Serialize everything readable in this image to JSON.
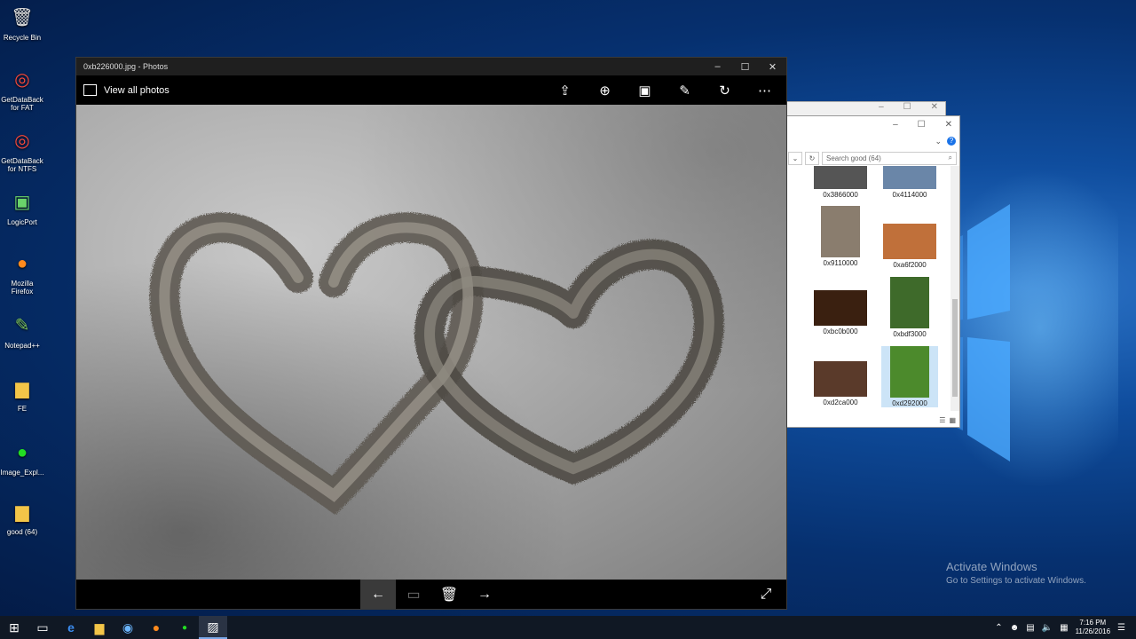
{
  "desktop": {
    "icons": [
      {
        "label": "Recycle Bin",
        "icon": "recycle-bin-icon"
      },
      {
        "label": "GetDataBack for FAT",
        "icon": "lifebuoy-icon"
      },
      {
        "label": "GetDataBack for NTFS",
        "icon": "lifebuoy-icon"
      },
      {
        "label": "LogicPort",
        "icon": "analyzer-icon"
      },
      {
        "label": "Mozilla Firefox",
        "icon": "firefox-icon"
      },
      {
        "label": "Notepad++",
        "icon": "notepad-icon"
      },
      {
        "label": "FE",
        "icon": "folder-icon"
      },
      {
        "label": "Image_Expl...",
        "icon": "green-dot-icon"
      },
      {
        "label": "good (64)",
        "icon": "folder-icon"
      }
    ]
  },
  "explorer": {
    "search_placeholder": "Search good (64)",
    "thumbnails": [
      {
        "label": "0x3866000",
        "color": "#555"
      },
      {
        "label": "0x4114000",
        "color": "#6a86a8"
      },
      {
        "label": "0x9110000",
        "color": "#8a7d6e"
      },
      {
        "label": "0xa6f2000",
        "color": "#c0703a"
      },
      {
        "label": "0xbc0b000",
        "color": "#3a2010"
      },
      {
        "label": "0xbdf3000",
        "color": "#3e6a2a"
      },
      {
        "label": "0xd2ca000",
        "color": "#5a3a2a"
      },
      {
        "label": "0xd292000",
        "color": "#4c8a2c"
      }
    ]
  },
  "photos": {
    "title": "0xb226000.jpg - Photos",
    "view_all_label": "View all photos",
    "toolbar_icons": [
      "share-icon",
      "zoom-icon",
      "slideshow-icon",
      "edit-icon",
      "rotate-icon",
      "more-icon"
    ]
  },
  "watermark": {
    "line1": "Activate Windows",
    "line2": "Go to Settings to activate Windows."
  },
  "taskbar": {
    "time": "7:16 PM",
    "date": "11/26/2016"
  }
}
